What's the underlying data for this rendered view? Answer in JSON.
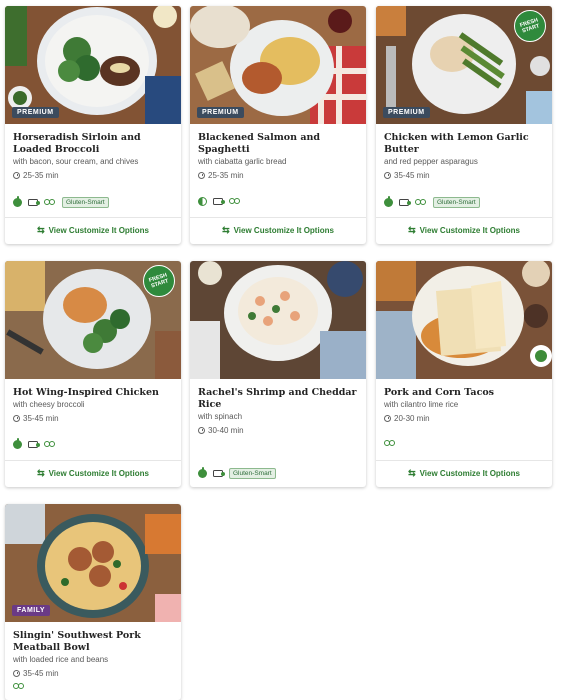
{
  "cards": [
    {
      "title": "Horseradish Sirloin and Loaded Broccoli",
      "subtitle": "with bacon, sour cream, and chives",
      "time": "25-35 min",
      "badge": "PREMIUM",
      "tags": [
        "fresh-apple-icon",
        "card-icon",
        "swap-icon"
      ],
      "tag_label": "Gluten-Smart",
      "action": "View Customize It Options"
    },
    {
      "title": "Blackened Salmon and Spaghetti",
      "subtitle": "with ciabatta garlic bread",
      "time": "25-35 min",
      "badge": "PREMIUM",
      "tags": [
        "apple-half-icon",
        "card-icon",
        "swap-icon"
      ],
      "action": "View Customize It Options"
    },
    {
      "title": "Chicken with Lemon Garlic Butter",
      "subtitle": "and red pepper asparagus",
      "time": "35-45 min",
      "badge": "PREMIUM",
      "fresh_start": "FRESH START",
      "tags": [
        "fresh-apple-icon",
        "card-icon",
        "swap-icon"
      ],
      "tag_label": "Gluten-Smart",
      "action": "View Customize It Options"
    },
    {
      "title": "Hot Wing-Inspired Chicken",
      "subtitle": "with cheesy broccoli",
      "time": "35-45 min",
      "fresh_start": "FRESH START",
      "tags": [
        "fresh-apple-icon",
        "card-icon",
        "swap-icon"
      ],
      "action": "View Customize It Options"
    },
    {
      "title": "Rachel's Shrimp and Cheddar Rice",
      "subtitle": "with spinach",
      "time": "30-40 min",
      "tags": [
        "fresh-apple-icon",
        "card-icon"
      ],
      "tag_label": "Gluten-Smart"
    },
    {
      "title": "Pork and Corn Tacos",
      "subtitle": "with cilantro lime rice",
      "time": "20-30 min",
      "tags": [
        "swap-icon"
      ],
      "action": "View Customize It Options"
    },
    {
      "title": "Slingin' Southwest Pork Meatball Bowl",
      "subtitle": "with loaded rice and beans",
      "time": "35-45 min",
      "badge": "FAMILY",
      "tags": [
        "swap-icon"
      ]
    }
  ],
  "colors": {
    "green": "#2e7d32",
    "premium_badge": "#3b4b5e",
    "family_badge": "#6a3a86",
    "fresh_start": "#2f8a3c"
  }
}
